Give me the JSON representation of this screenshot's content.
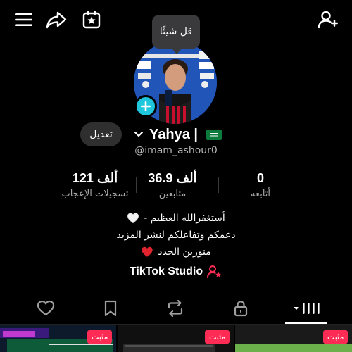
{
  "header": {
    "icons": [
      "menu-icon",
      "share-icon",
      "calendar-star-icon",
      "add-user-icon"
    ]
  },
  "tooltip": {
    "text": "قل شيئًا"
  },
  "profile": {
    "edit_label": "تعديل",
    "display_name": "Yahya | ",
    "username": "@imam_ashour0",
    "stats": [
      {
        "value": "121 ألف",
        "label": "تسجيلات الإعجاب"
      },
      {
        "value": "36.9 ألف",
        "label": "متابعين"
      },
      {
        "value": "0",
        "label": "أتابعه"
      }
    ],
    "bio": [
      "أستغفرالله العظيم - ",
      "دعمكم وتفاعلكم لنشر المزيد",
      "منورين الجدد "
    ],
    "studio_link": "TikTok Studio"
  },
  "tabs": [
    "grid-tab",
    "lock-tab",
    "repost-tab",
    "bookmark-tab",
    "liked-tab"
  ],
  "videos": [
    {
      "pinned_label": "مثبت"
    },
    {
      "pinned_label": "مثبت"
    },
    {
      "pinned_label": "مثبت"
    }
  ],
  "colors": {
    "accent": "#fe2c55",
    "plus": "#1fc7dc",
    "background": "#000000"
  }
}
